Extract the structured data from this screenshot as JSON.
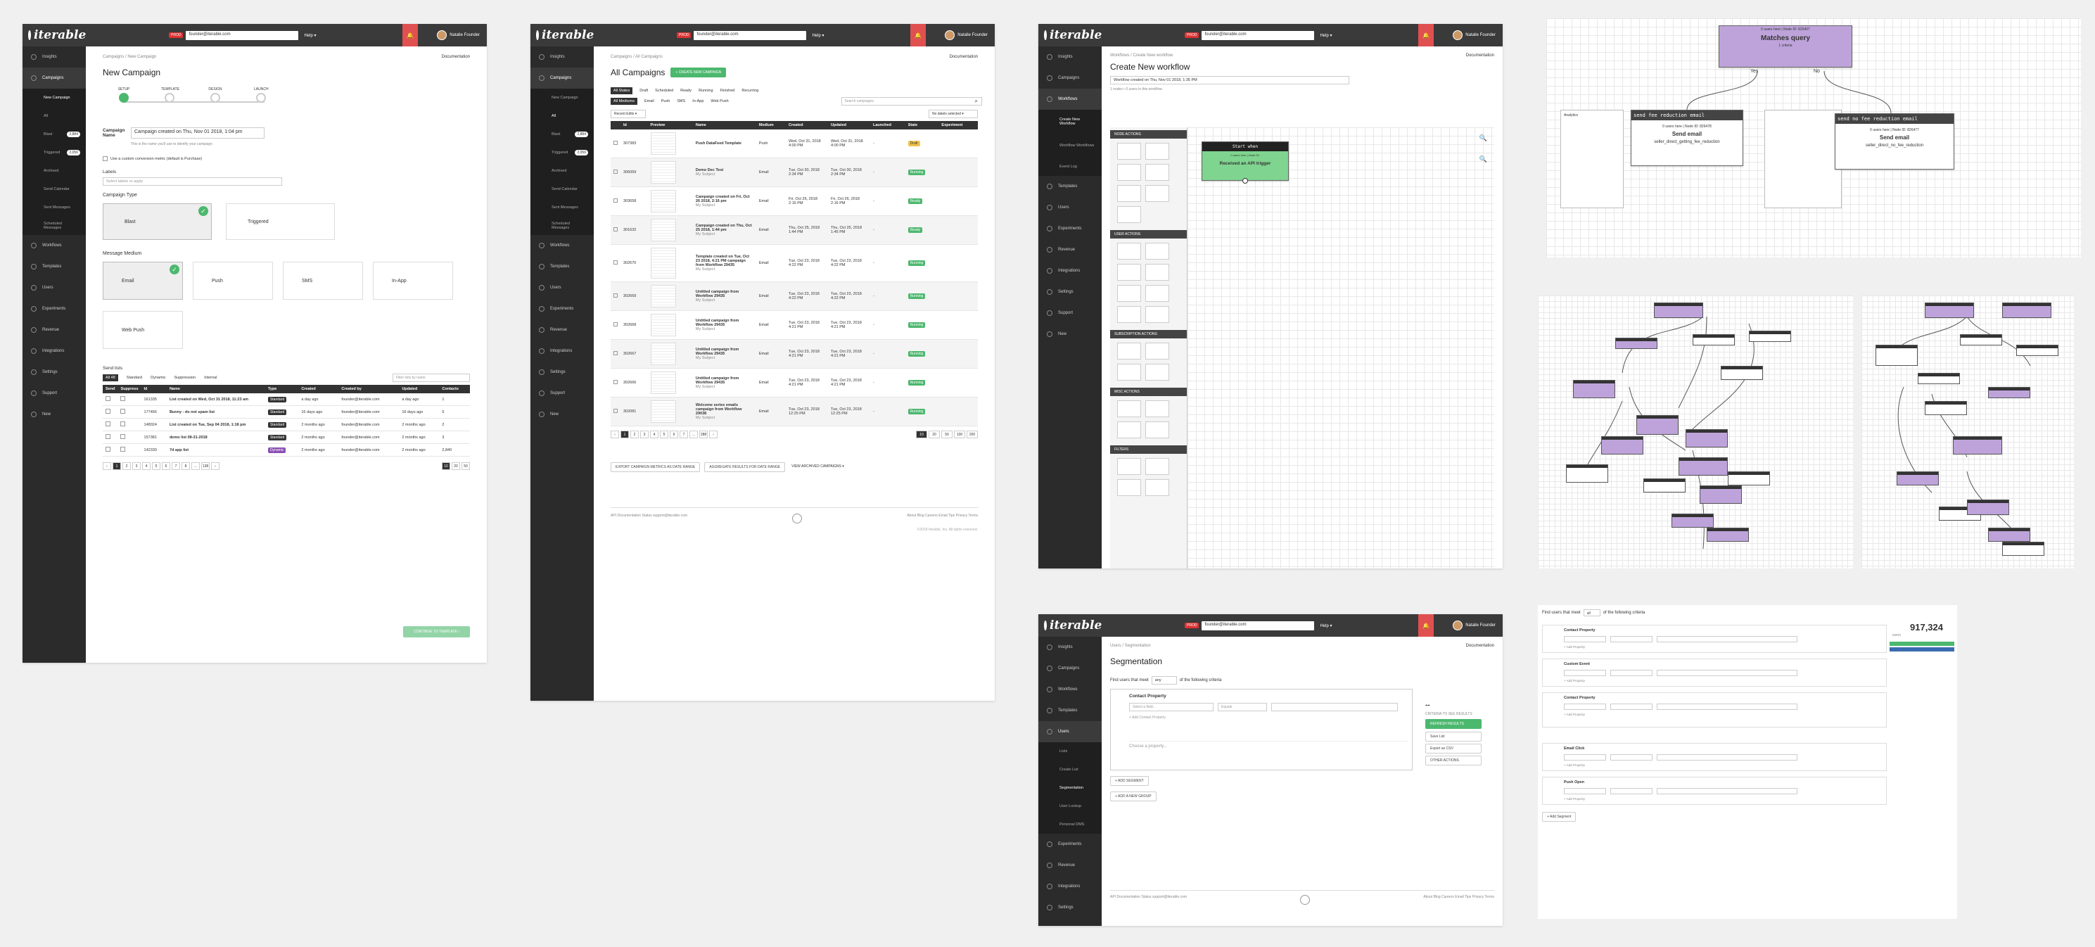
{
  "brand": {
    "logo": "iterable",
    "env": "PROD",
    "project": "founder@iterable.com",
    "help": "Help ▾",
    "user": "Natalie Founder"
  },
  "nav": [
    "Insights",
    "Campaigns",
    "Workflows",
    "Templates",
    "Users",
    "Experiments",
    "Revenue",
    "Integrations",
    "Settings",
    "Support",
    "New"
  ],
  "s1": {
    "crumb": "Campaigns  /  New Campaign",
    "docs": "Documentation",
    "title": "New Campaign",
    "sub": [
      "All",
      "Blast",
      "Triggered",
      "Archived",
      "Send Calendar",
      "Sent Messages",
      "Scheduled Messages"
    ],
    "sub_counts": [
      "",
      "2,884",
      "2,056",
      "518",
      "",
      "",
      ""
    ],
    "steps": [
      "SETUP",
      "TEMPLATE",
      "DESIGN",
      "LAUNCH"
    ],
    "name_label": "Campaign Name",
    "name_value": "Campaign created on Thu, Nov 01 2018, 1:04 pm",
    "name_hint": "This is the name you'll use to identify your campaign",
    "conversion": "Use a custom conversion metric (default is Purchase)",
    "labels_label": "Labels",
    "labels_ph": "Select labels or apply",
    "type_label": "Campaign Type",
    "types": [
      "Blast",
      "Triggered"
    ],
    "medium_label": "Message Medium",
    "mediums": [
      "Email",
      "Push",
      "SMS",
      "In-App",
      "Web Push"
    ],
    "lists_label": "Send lists",
    "list_tabs": [
      "All",
      "Standard",
      "Dynamic",
      "Suppression",
      "Internal"
    ],
    "list_tab_count": "48",
    "filter_ph": "Filter lists by name",
    "cols": [
      "Send",
      "Suppress",
      "Id",
      "Name",
      "Type",
      "Created",
      "Created by",
      "Updated",
      "Contacts"
    ],
    "rows": [
      [
        "161335",
        "List created on Wed, Oct 31 2018, 11:23 am",
        "Standard",
        "a day ago",
        "founder@iterable.com",
        "a day ago",
        "1"
      ],
      [
        "177456",
        "Bunny - do not spam list",
        "Standard",
        "16 days ago",
        "founder@iterable.com",
        "16 days ago",
        "5"
      ],
      [
        "148024",
        "List created on Tue, Sep 04 2018, 1:18 pm",
        "Standard",
        "2 months ago",
        "founder@iterable.com",
        "2 months ago",
        "2"
      ],
      [
        "157381",
        "demo list 08-31-2018",
        "Standard",
        "2 months ago",
        "founder@iterable.com",
        "2 months ago",
        "3"
      ],
      [
        "142330",
        "7d app list",
        "Dynamic",
        "2 months ago",
        "founder@iterable.com",
        "2 months ago",
        "2,840"
      ]
    ],
    "pages": [
      "1",
      "2",
      "3",
      "4",
      "5",
      "6",
      "7",
      "8",
      "...",
      "138"
    ],
    "per_page": [
      "10",
      "20",
      "50"
    ],
    "continue": "CONTINUE TO TEMPLATE ›"
  },
  "s2": {
    "crumb": "Campaigns  /  All Campaigns",
    "title": "All Campaigns",
    "create": "+ CREATE NEW CAMPAIGN",
    "tabs1": [
      "All States",
      "Draft",
      "Scheduled",
      "Ready",
      "Running",
      "Finished",
      "Recurring"
    ],
    "tabs2": [
      "All Mediums",
      "Email",
      "Push",
      "SMS",
      "In-App",
      "Web Push"
    ],
    "search_ph": "Search campaigns",
    "recent": "Recent Edits ▾",
    "no_labels": "No labels selected ▾",
    "cols": [
      "Id",
      "Preview",
      "Name",
      "Medium",
      "Created",
      "Updated",
      "Launched",
      "State",
      "Experiment"
    ],
    "rows": [
      [
        "307383",
        "Push DataFeed Template",
        "",
        "Push",
        "Wed, Oct 31, 2018 4:00 PM",
        "Wed, Oct 31, 2018 4:00 PM",
        "-",
        "Draft"
      ],
      [
        "306059",
        "Demo Dec Test",
        "My Subject",
        "Email",
        "Tue, Oct 30, 2018 2:34 PM",
        "Tue, Oct 30, 2018 2:34 PM",
        "-",
        "Running"
      ],
      [
        "303658",
        "Campaign created on Fri, Oct 26 2018, 2:16 pm",
        "My Subject",
        "Email",
        "Fri, Oct 26, 2018 2:16 PM",
        "Fri, Oct 26, 2018 2:16 PM",
        "-",
        "Ready"
      ],
      [
        "301632",
        "Campaign created on Thu, Oct 25 2018, 1:44 pm",
        "My Subject",
        "Email",
        "Thu, Oct 25, 2018 1:44 PM",
        "Thu, Oct 25, 2018 1:45 PM",
        "-",
        "Ready"
      ],
      [
        "302670",
        "Template created on Tue, Oct 23 2018, 4:21 PM campaign from Workflow 29435",
        "My Subject",
        "Email",
        "Tue, Oct 23, 2018 4:22 PM",
        "Tue, Oct 23, 2018 4:22 PM",
        "-",
        "Running"
      ],
      [
        "302669",
        "Untitled campaign from Workflow 29435",
        "My Subject",
        "Email",
        "Tue, Oct 23, 2018 4:22 PM",
        "Tue, Oct 23, 2018 4:22 PM",
        "-",
        "Running"
      ],
      [
        "302668",
        "Untitled campaign from Workflow 29435",
        "My Subject",
        "Email",
        "Tue, Oct 23, 2018 4:21 PM",
        "Tue, Oct 23, 2018 4:21 PM",
        "-",
        "Running"
      ],
      [
        "302667",
        "Untitled campaign from Workflow 29435",
        "My Subject",
        "Email",
        "Tue, Oct 23, 2018 4:21 PM",
        "Tue, Oct 23, 2018 4:21 PM",
        "-",
        "Running"
      ],
      [
        "302666",
        "Untitled campaign from Workflow 29435",
        "My Subject",
        "Email",
        "Tue, Oct 23, 2018 4:21 PM",
        "Tue, Oct 23, 2018 4:21 PM",
        "-",
        "Running"
      ],
      [
        "302081",
        "Welcome series emails campaign from Workflow 29038",
        "My Subject",
        "Email",
        "Tue, Oct 23, 2018 12:25 PM",
        "Tue, Oct 23, 2018 12:25 PM",
        "-",
        "Running"
      ]
    ],
    "pages": [
      "1",
      "2",
      "3",
      "4",
      "5",
      "6",
      "7",
      "...",
      "288"
    ],
    "per_page": [
      "10",
      "20",
      "50",
      "100",
      "200"
    ],
    "export1": "EXPORT CAMPAIGN METRICS AS DATE RANGE",
    "export2": "AGGREGATE RESULTS FOR DATE RANGE",
    "archived": "VIEW ARCHIVED CAMPAIGNS ▾",
    "footer_l": "API   Documentation   Status   support@iterable.com",
    "footer_r": "About   Blog   Careers   Email Tips   Privacy   Terms",
    "copyright": "©2018 Iterable, Inc. All rights reserved."
  },
  "s3": {
    "crumb": "Workflows  /  Create New workflow",
    "title": "Create New workflow",
    "name": "Workflow created on Thu, Nov 01 2018, 1:35 PM",
    "meta": "1 nodes • 0 users in this workflow",
    "sub": [
      "Create New Workflow",
      "Workflow Workflows",
      "Event Log"
    ],
    "groups": [
      "NODE ACTIONS",
      "USER ACTIONS",
      "SUBSCRIPTION ACTIONS",
      "MISC ACTIONS",
      "FILTERS"
    ],
    "start_head": "Start when",
    "start_sub": "0 users here | Node ID:",
    "start_body": "Received an API trigger"
  },
  "s4": {
    "node_top_head": "0 users here | Node ID: 826407",
    "node_top_title": "Matches query",
    "node_top_sub": "1 criteria",
    "yes": "Yes",
    "no": "No",
    "left_head": "send fee reduction email",
    "left_sub": "0 users here | Node ID: 826478",
    "left_title": "Send email",
    "left_body": "seller_direct_getting_fee_reduction",
    "right_head": "send no fee reduction email",
    "right_sub": "0 users here | Node ID: 826477",
    "right_title": "Send email",
    "right_body": "seller_direct_no_fee_reduction",
    "analytics": "Analytics"
  },
  "s5": {
    "crumb": "Users  /  Segmentation",
    "title": "Segmentation",
    "sub": [
      "Lists",
      "Create List",
      "Segmentation",
      "User Lookup",
      "Personal DMS"
    ],
    "find1": "Find users that meet",
    "any": "any",
    "find2": "of the following criteria",
    "prop": "Contact Property",
    "field_ph": "Select a field...",
    "equals": "Equals",
    "add_prop": "+ Add Contact Property",
    "choose": "Choose a property...",
    "add_seg": "+ ADD SEGMENT",
    "add_group": "+ ADD A NEW GROUP",
    "refresh": "REFRESH RESULTS",
    "actions": [
      "Save List",
      "Export as CSV",
      "OTHER ACTIONS"
    ],
    "dash": "--",
    "count_label": "CRITERIA TO SEE RESULTS"
  },
  "s6": {
    "find1": "Find users that meet",
    "all": "all",
    "find2": "of the following criteria",
    "count": "917,324",
    "count_label": "users",
    "groups": [
      "Contact Property",
      "Custom Event",
      "Contact Property",
      "Email Click",
      "Push Open"
    ],
    "add": "+ Add Property",
    "add_group": "+ Add Segment"
  },
  "colors": {
    "accent": "#4cb86e",
    "purple": "#bda3da",
    "dark": "#2b2b2b",
    "red": "#e05050"
  }
}
